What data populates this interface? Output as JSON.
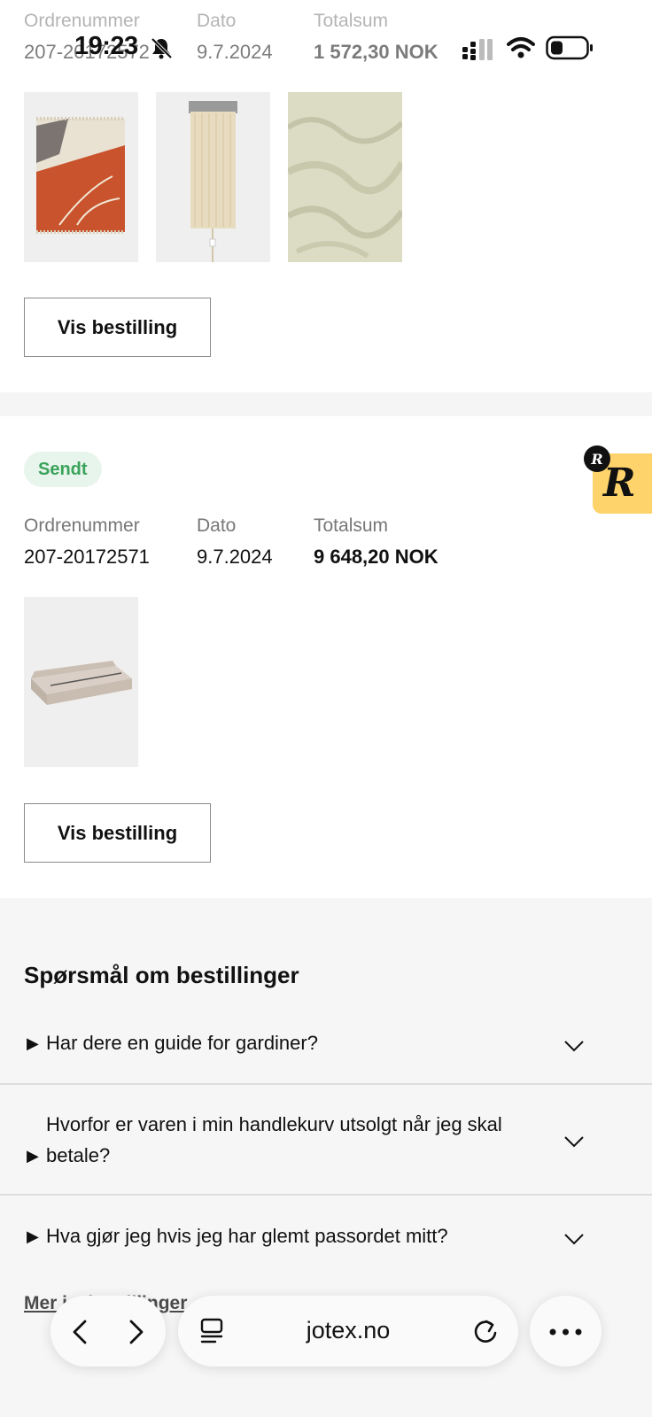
{
  "status_bar": {
    "time": "19:23",
    "icons": [
      "bell-muted-icon",
      "signal-icon",
      "wifi-icon",
      "battery-icon"
    ]
  },
  "order_prev": {
    "labels": {
      "order_number": "Ordrenummer",
      "date": "Dato",
      "total": "Totalsum"
    },
    "order_number": "207-20172572",
    "date": "9.7.2024",
    "total": "1 572,30 NOK",
    "images": [
      "throw-blanket-image",
      "fringe-lamp-image",
      "bedspread-image"
    ],
    "button_label": "Vis bestilling"
  },
  "order_current": {
    "status": "Sendt",
    "labels": {
      "order_number": "Ordrenummer",
      "date": "Dato",
      "total": "Totalsum"
    },
    "order_number": "207-20172571",
    "date": "9.7.2024",
    "total": "9 648,20 NOK",
    "images": [
      "bed-frame-image"
    ],
    "button_label": "Vis bestilling"
  },
  "floating_badge": {
    "letter": "R"
  },
  "faq": {
    "title": "Spørsmål om bestillinger",
    "items": [
      {
        "question": "Har dere en guide for gardiner?"
      },
      {
        "question": "Hvorfor er varen i min handlekurv utsolgt når jeg skal betale?"
      },
      {
        "question": "Hva gjør jeg hvis jeg har glemt passordet mitt?"
      }
    ],
    "more_link": "Mer i... bestillinger"
  },
  "browser": {
    "url": "jotex.no",
    "buttons": [
      "back-icon",
      "forward-icon",
      "tabs-icon",
      "reload-icon",
      "more-icon"
    ]
  },
  "colors": {
    "badge_green": "#3aa35a",
    "badge_bg": "#e8f5ec",
    "floating_yellow": "#ffd36b",
    "section_gray": "#f5f5f5"
  }
}
